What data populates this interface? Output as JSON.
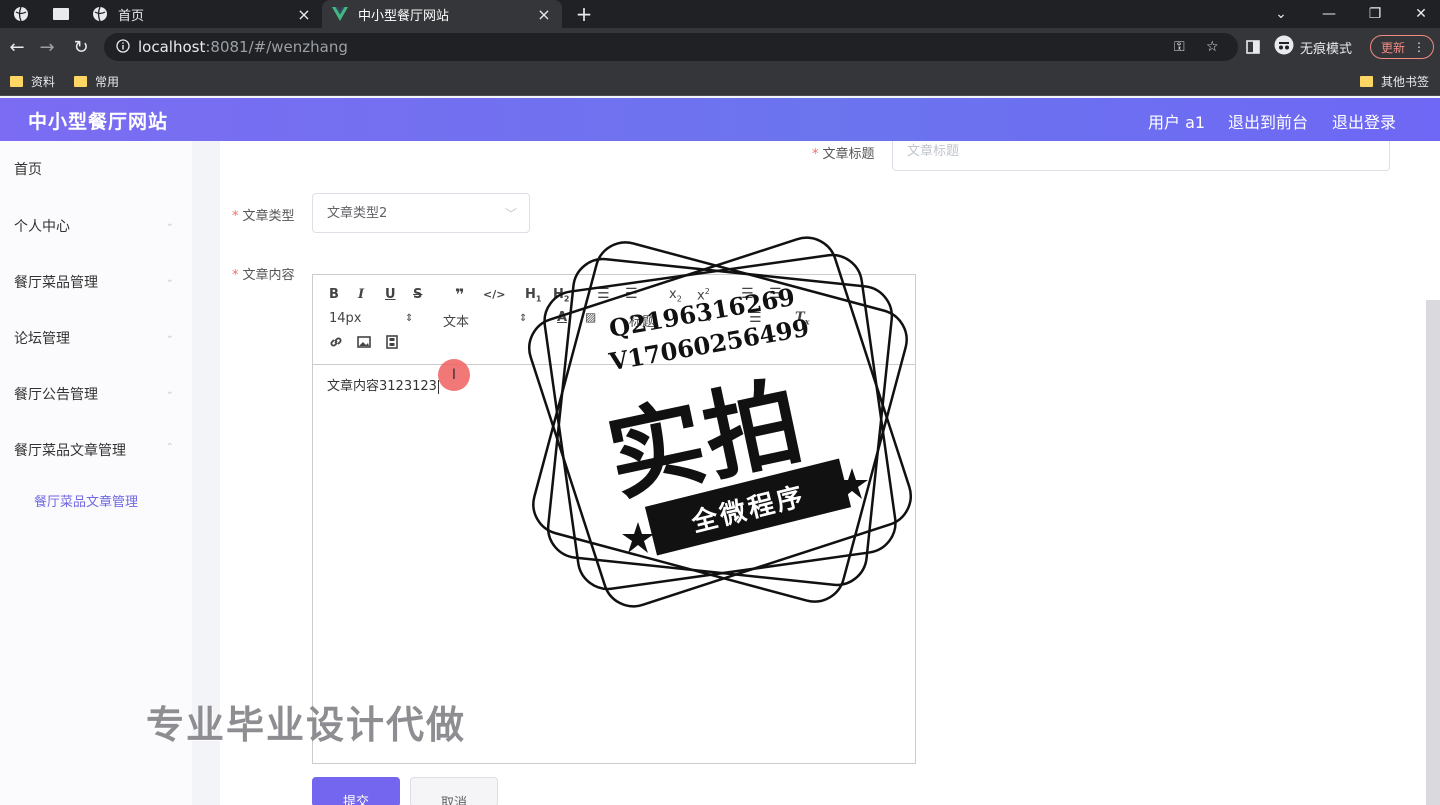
{
  "browser": {
    "tabs": [
      {
        "title": "首页"
      },
      {
        "title": "中小型餐厅网站"
      }
    ],
    "url_host": "localhost",
    "url_rest": ":8081/#/wenzhang",
    "incognito_label": "无痕模式",
    "update_label": "更新",
    "bookmarks": [
      "资料",
      "常用"
    ],
    "other_bookmarks": "其他书签"
  },
  "header": {
    "title": "中小型餐厅网站",
    "user": "用户 a1",
    "to_front": "退出到前台",
    "logout": "退出登录"
  },
  "sidebar": {
    "items": [
      {
        "label": "首页"
      },
      {
        "label": "个人中心"
      },
      {
        "label": "餐厅菜品管理"
      },
      {
        "label": "论坛管理"
      },
      {
        "label": "餐厅公告管理"
      },
      {
        "label": "餐厅菜品文章管理"
      }
    ],
    "sub_item": "餐厅菜品文章管理"
  },
  "form": {
    "title_label": "文章标题",
    "title_placeholder": "文章标题",
    "type_label": "文章类型",
    "type_value": "文章类型2",
    "content_label": "文章内容",
    "content_value": "文章内容3123123",
    "toolbar": {
      "font_size": "14px",
      "block": "文本",
      "heading": "标题"
    },
    "submit": "提交",
    "cancel": "取消"
  },
  "watermark": {
    "line1": "Q2196316269",
    "line2": "V17060256499",
    "big": "实拍",
    "ribbon": "全微程序",
    "bottom": "专业毕业设计代做"
  }
}
